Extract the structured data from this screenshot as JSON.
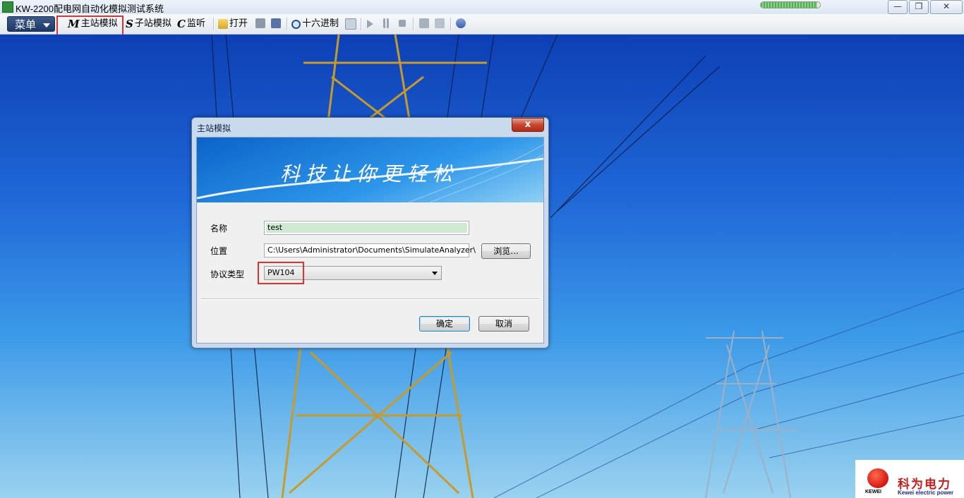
{
  "window": {
    "title": "KW-2200配电网自动化模拟测试系统",
    "progress_fraction": 0.95,
    "controls": {
      "minimize": "—",
      "restore": "❐",
      "close": "✕"
    }
  },
  "toolbar": {
    "menu_label": "菜单",
    "master_sim_label": "主站模拟",
    "slave_sim_label": "子站模拟",
    "monitor_label": "监听",
    "open_label": "打开",
    "hex_label": "十六进制",
    "icons": {
      "master": "M",
      "slave": "S",
      "monitor": "C"
    }
  },
  "dialog": {
    "title": "主站模拟",
    "close_label": "x",
    "banner_text": "科技让你更轻松",
    "name_label": "名称",
    "name_value": "test",
    "location_label": "位置",
    "location_value": "C:\\Users\\Administrator\\Documents\\SimulateAnalyzer\\",
    "browse_label": "浏览...",
    "protocol_label": "协议类型",
    "protocol_value": "PW104",
    "ok_label": "确定",
    "cancel_label": "取消"
  },
  "logo": {
    "badge_text": "KEWEI",
    "name_cn": "科为电力",
    "name_en": "Kewei electric power"
  },
  "colors": {
    "highlight": "#e23131",
    "accent": "#1e3868"
  }
}
